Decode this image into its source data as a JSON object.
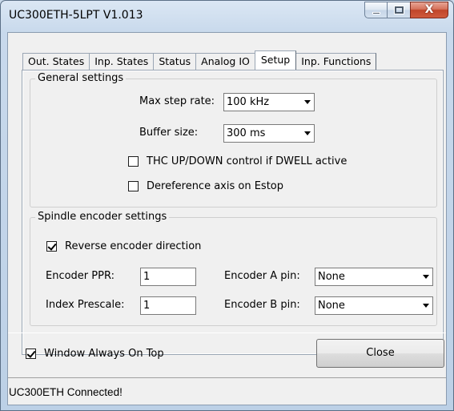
{
  "window": {
    "title": "UC300ETH-5LPT V1.013",
    "close_glyph": "X"
  },
  "tabs": [
    {
      "label": "Out. States"
    },
    {
      "label": "Inp. States"
    },
    {
      "label": "Status"
    },
    {
      "label": "Analog IO"
    },
    {
      "label": "Setup",
      "active": true
    },
    {
      "label": "Inp. Functions"
    }
  ],
  "general": {
    "legend": "General settings",
    "max_step_rate_label": "Max step rate:",
    "max_step_rate_value": "100 kHz",
    "buffer_size_label": "Buffer size:",
    "buffer_size_value": "300 ms",
    "thc_label": "THC UP/DOWN control if DWELL active",
    "thc_checked": false,
    "dereference_label": "Dereference axis on Estop",
    "dereference_checked": false
  },
  "spindle": {
    "legend": "Spindle encoder settings",
    "reverse_label": "Reverse encoder direction",
    "reverse_checked": true,
    "ppr_label": "Encoder PPR:",
    "ppr_value": "1",
    "prescale_label": "Index Prescale:",
    "prescale_value": "1",
    "a_pin_label": "Encoder A pin:",
    "a_pin_value": "None",
    "b_pin_label": "Encoder B pin:",
    "b_pin_value": "None"
  },
  "footer": {
    "always_on_top_label": "Window Always On Top",
    "always_on_top_checked": true,
    "close_label": "Close"
  },
  "status": {
    "text": "UC300ETH Connected!"
  }
}
